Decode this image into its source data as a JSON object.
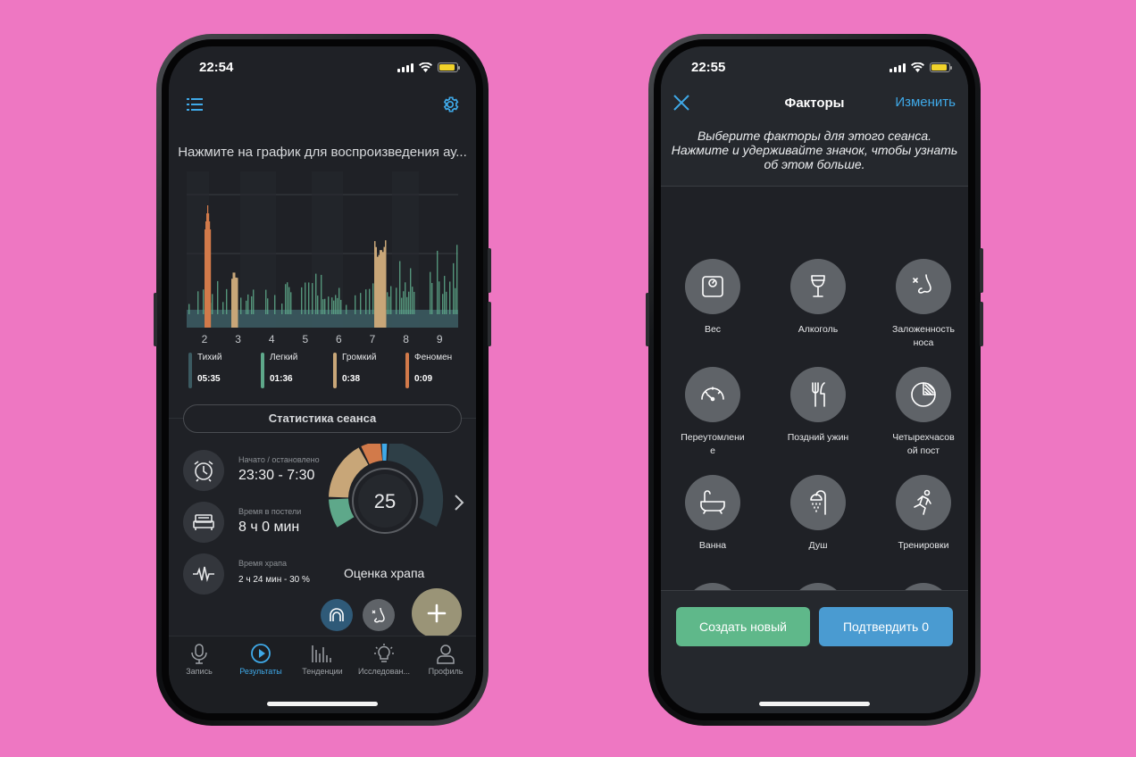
{
  "left_screen": {
    "status": {
      "time": "22:54"
    },
    "hint": "Нажмите на график для воспроизведения ау...",
    "chart_data": {
      "type": "bar",
      "x_ticks": [
        "2",
        "3",
        "4",
        "5",
        "6",
        "7",
        "8",
        "9"
      ],
      "series": [
        {
          "name": "Тихий",
          "color": "#3b5a61"
        },
        {
          "name": "Легкий",
          "color": "#5ea88a"
        },
        {
          "name": "Громкий",
          "color": "#c8a678"
        },
        {
          "name": "Феномен",
          "color": "#d27a4a"
        }
      ],
      "grid": true
    },
    "legend": [
      {
        "label": "Тихий",
        "value": "05:35",
        "color": "#3b5a61"
      },
      {
        "label": "Легкий",
        "value": "01:36",
        "color": "#5ea88a"
      },
      {
        "label": "Громкий",
        "value": "0:38",
        "color": "#c8a678"
      },
      {
        "label": "Феномен",
        "value": "0:09",
        "color": "#d27a4a"
      }
    ],
    "stats_button": "Статистика сеанса",
    "stats": {
      "start_stop_label": "Начато / остановлено",
      "start_stop_value": "23:30 - 7:30",
      "time_in_bed_label": "Время в постели",
      "time_in_bed_value": "8 ч 0 мин",
      "snore_time_label": "Время храпа",
      "snore_time_value": "2 ч 24 мин - 30 %"
    },
    "score": {
      "value": "25",
      "label": "Оценка храпа"
    },
    "tabs": [
      {
        "label": "Запись",
        "icon": "microphone-icon"
      },
      {
        "label": "Результаты",
        "icon": "play-icon",
        "active": true
      },
      {
        "label": "Тенденции",
        "icon": "bars-icon"
      },
      {
        "label": "Исследован...",
        "icon": "bulb-icon"
      },
      {
        "label": "Профиль",
        "icon": "person-icon"
      }
    ]
  },
  "right_screen": {
    "status": {
      "time": "22:55"
    },
    "nav": {
      "title": "Факторы",
      "edit": "Изменить"
    },
    "instructions": "Выберите факторы для этого сеанса. Нажмите и удерживайте значок, чтобы узнать об этом больше.",
    "factors": [
      {
        "label": "Вес",
        "icon": "scale-icon"
      },
      {
        "label": "Алкоголь",
        "icon": "wine-glass-icon"
      },
      {
        "label": "Заложенность носа",
        "icon": "nose-icon"
      },
      {
        "label": "Переутомление",
        "icon": "speedometer-icon"
      },
      {
        "label": "Поздний ужин",
        "icon": "fork-knife-icon"
      },
      {
        "label": "Четырехчасовой пост",
        "icon": "pie-clock-icon"
      },
      {
        "label": "Ванна",
        "icon": "bathtub-icon"
      },
      {
        "label": "Душ",
        "icon": "shower-icon"
      },
      {
        "label": "Тренировки",
        "icon": "running-icon"
      },
      {
        "label": "",
        "icon": "bed-icon"
      },
      {
        "label": "",
        "icon": "pills-icon"
      },
      {
        "label": "",
        "icon": "sun-icon"
      }
    ],
    "buttons": {
      "create": "Создать новый",
      "confirm": "Подтвердить 0"
    },
    "colors": {
      "create": "#5fb88a",
      "confirm": "#4a9bd1",
      "accent": "#3fa9e8"
    }
  }
}
